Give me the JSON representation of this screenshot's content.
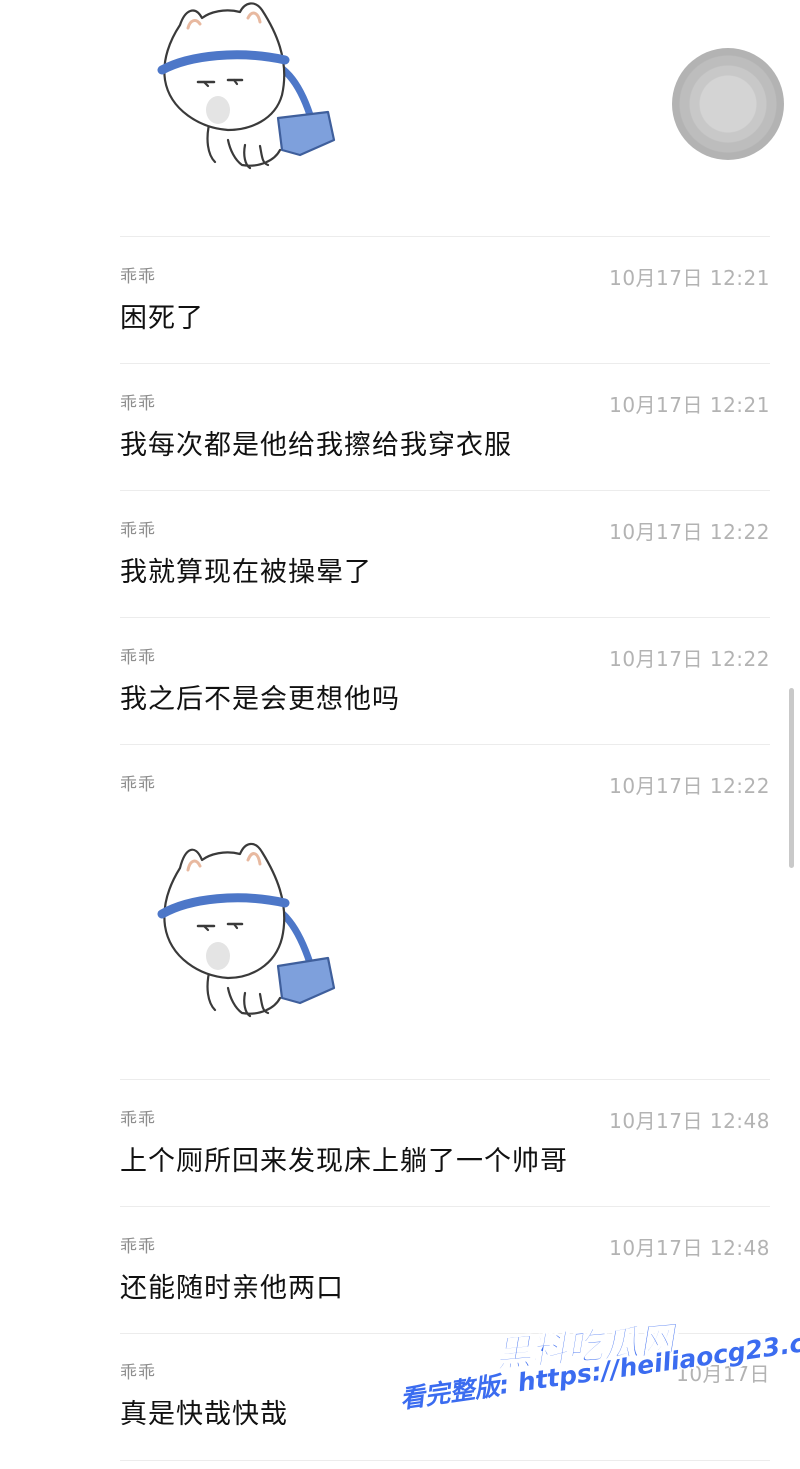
{
  "messages": [
    {
      "sender": "乖乖",
      "time": "10月17日 12:21",
      "text": "困死了"
    },
    {
      "sender": "乖乖",
      "time": "10月17日 12:21",
      "text": "我每次都是他给我擦给我穿衣服"
    },
    {
      "sender": "乖乖",
      "time": "10月17日 12:22",
      "text": "我就算现在被操晕了"
    },
    {
      "sender": "乖乖",
      "time": "10月17日 12:22",
      "text": "我之后不是会更想他吗"
    },
    {
      "sender": "乖乖",
      "time": "10月17日 12:22",
      "sticker": "cat-with-blue-bag-sticker"
    },
    {
      "sender": "乖乖",
      "time": "10月17日 12:48",
      "text": "上个厕所回来发现床上躺了一个帅哥"
    },
    {
      "sender": "乖乖",
      "time": "10月17日 12:48",
      "text": "还能随时亲他两口"
    },
    {
      "sender": "乖乖",
      "time": "10月17日",
      "text": "真是快哉快哉"
    }
  ],
  "top_sticker": "cat-with-blue-bag-sticker",
  "watermark": {
    "title": "黑料吃瓜网",
    "url_line": "看完整版: https://heiliaocg23.com",
    "color": "#3b6cf0"
  },
  "colors": {
    "background": "#ffffff",
    "sender": "#8e8e8e",
    "time": "#b3b3b3",
    "text": "#111111",
    "divider": "#ececec"
  }
}
